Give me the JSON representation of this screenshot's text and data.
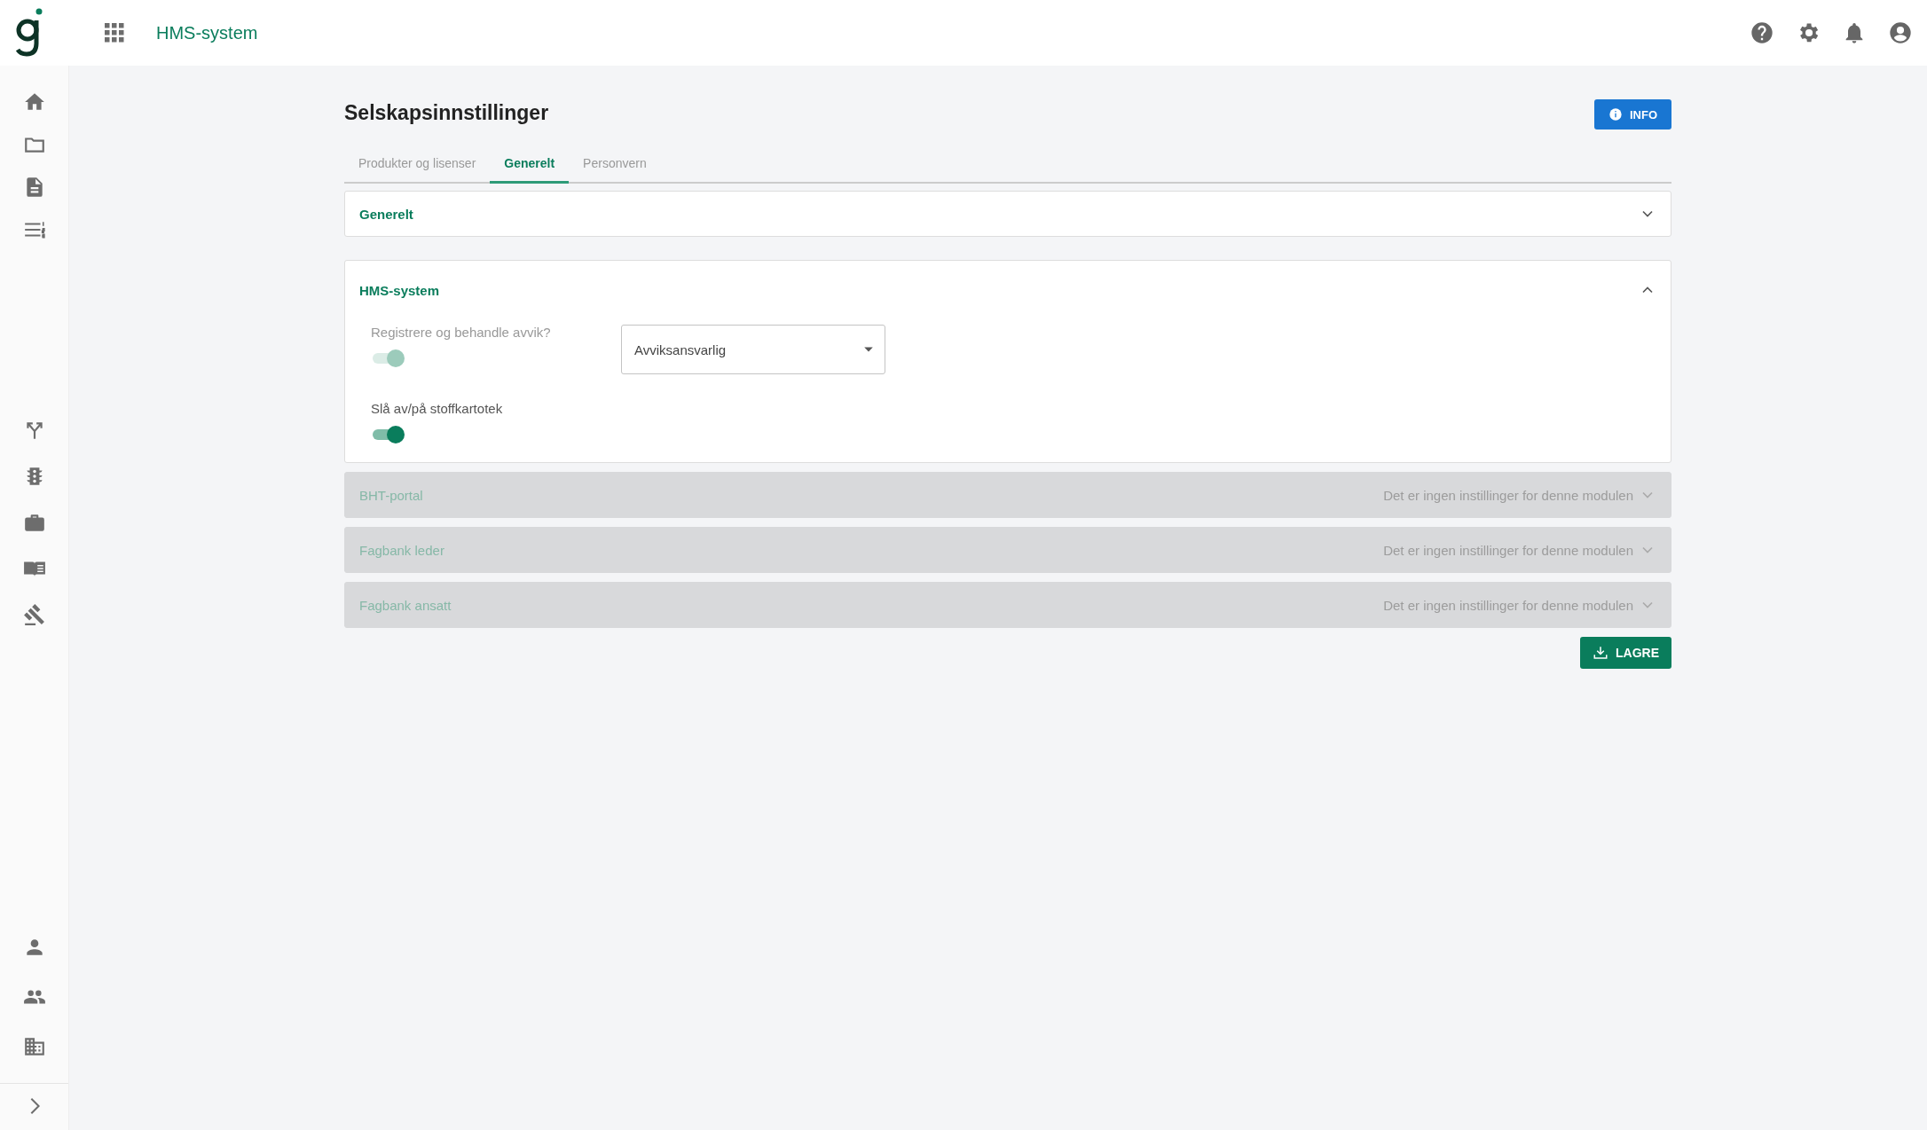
{
  "app_bar": {
    "title": "HMS-system"
  },
  "page": {
    "title": "Selskapsinnstillinger",
    "info_button": "INFO"
  },
  "tabs": [
    {
      "label": "Produkter og lisenser",
      "selected": false
    },
    {
      "label": "Generelt",
      "selected": true
    },
    {
      "label": "Personvern",
      "selected": false
    }
  ],
  "panels": [
    {
      "title": "Generelt",
      "expanded": false,
      "disabled": false
    },
    {
      "title": "HMS-system",
      "expanded": true,
      "disabled": false,
      "settings": [
        {
          "label": "Registrere og behandle avvik?",
          "checked": true,
          "disabled": true,
          "select": {
            "value": "Avviksansvarlig"
          }
        },
        {
          "label": "Slå av/på stoffkartotek",
          "checked": true,
          "disabled": false
        }
      ]
    },
    {
      "title": "BHT-portal",
      "expanded": false,
      "disabled": true,
      "note": "Det er ingen instillinger for denne modulen"
    },
    {
      "title": "Fagbank leder",
      "expanded": false,
      "disabled": true,
      "note": "Det er ingen instillinger for denne modulen"
    },
    {
      "title": "Fagbank ansatt",
      "expanded": false,
      "disabled": true,
      "note": "Det er ingen instillinger for denne modulen"
    }
  ],
  "save_button": "LAGRE"
}
